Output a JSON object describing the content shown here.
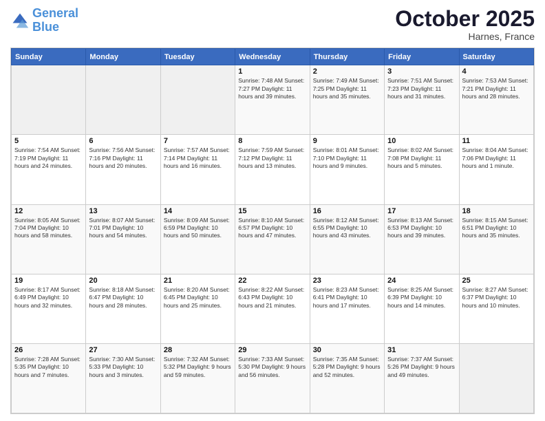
{
  "header": {
    "logo_line1": "General",
    "logo_line2": "Blue",
    "month": "October 2025",
    "location": "Harnes, France"
  },
  "weekdays": [
    "Sunday",
    "Monday",
    "Tuesday",
    "Wednesday",
    "Thursday",
    "Friday",
    "Saturday"
  ],
  "weeks": [
    [
      {
        "day": "",
        "info": ""
      },
      {
        "day": "",
        "info": ""
      },
      {
        "day": "",
        "info": ""
      },
      {
        "day": "1",
        "info": "Sunrise: 7:48 AM\nSunset: 7:27 PM\nDaylight: 11 hours\nand 39 minutes."
      },
      {
        "day": "2",
        "info": "Sunrise: 7:49 AM\nSunset: 7:25 PM\nDaylight: 11 hours\nand 35 minutes."
      },
      {
        "day": "3",
        "info": "Sunrise: 7:51 AM\nSunset: 7:23 PM\nDaylight: 11 hours\nand 31 minutes."
      },
      {
        "day": "4",
        "info": "Sunrise: 7:53 AM\nSunset: 7:21 PM\nDaylight: 11 hours\nand 28 minutes."
      }
    ],
    [
      {
        "day": "5",
        "info": "Sunrise: 7:54 AM\nSunset: 7:19 PM\nDaylight: 11 hours\nand 24 minutes."
      },
      {
        "day": "6",
        "info": "Sunrise: 7:56 AM\nSunset: 7:16 PM\nDaylight: 11 hours\nand 20 minutes."
      },
      {
        "day": "7",
        "info": "Sunrise: 7:57 AM\nSunset: 7:14 PM\nDaylight: 11 hours\nand 16 minutes."
      },
      {
        "day": "8",
        "info": "Sunrise: 7:59 AM\nSunset: 7:12 PM\nDaylight: 11 hours\nand 13 minutes."
      },
      {
        "day": "9",
        "info": "Sunrise: 8:01 AM\nSunset: 7:10 PM\nDaylight: 11 hours\nand 9 minutes."
      },
      {
        "day": "10",
        "info": "Sunrise: 8:02 AM\nSunset: 7:08 PM\nDaylight: 11 hours\nand 5 minutes."
      },
      {
        "day": "11",
        "info": "Sunrise: 8:04 AM\nSunset: 7:06 PM\nDaylight: 11 hours\nand 1 minute."
      }
    ],
    [
      {
        "day": "12",
        "info": "Sunrise: 8:05 AM\nSunset: 7:04 PM\nDaylight: 10 hours\nand 58 minutes."
      },
      {
        "day": "13",
        "info": "Sunrise: 8:07 AM\nSunset: 7:01 PM\nDaylight: 10 hours\nand 54 minutes."
      },
      {
        "day": "14",
        "info": "Sunrise: 8:09 AM\nSunset: 6:59 PM\nDaylight: 10 hours\nand 50 minutes."
      },
      {
        "day": "15",
        "info": "Sunrise: 8:10 AM\nSunset: 6:57 PM\nDaylight: 10 hours\nand 47 minutes."
      },
      {
        "day": "16",
        "info": "Sunrise: 8:12 AM\nSunset: 6:55 PM\nDaylight: 10 hours\nand 43 minutes."
      },
      {
        "day": "17",
        "info": "Sunrise: 8:13 AM\nSunset: 6:53 PM\nDaylight: 10 hours\nand 39 minutes."
      },
      {
        "day": "18",
        "info": "Sunrise: 8:15 AM\nSunset: 6:51 PM\nDaylight: 10 hours\nand 35 minutes."
      }
    ],
    [
      {
        "day": "19",
        "info": "Sunrise: 8:17 AM\nSunset: 6:49 PM\nDaylight: 10 hours\nand 32 minutes."
      },
      {
        "day": "20",
        "info": "Sunrise: 8:18 AM\nSunset: 6:47 PM\nDaylight: 10 hours\nand 28 minutes."
      },
      {
        "day": "21",
        "info": "Sunrise: 8:20 AM\nSunset: 6:45 PM\nDaylight: 10 hours\nand 25 minutes."
      },
      {
        "day": "22",
        "info": "Sunrise: 8:22 AM\nSunset: 6:43 PM\nDaylight: 10 hours\nand 21 minutes."
      },
      {
        "day": "23",
        "info": "Sunrise: 8:23 AM\nSunset: 6:41 PM\nDaylight: 10 hours\nand 17 minutes."
      },
      {
        "day": "24",
        "info": "Sunrise: 8:25 AM\nSunset: 6:39 PM\nDaylight: 10 hours\nand 14 minutes."
      },
      {
        "day": "25",
        "info": "Sunrise: 8:27 AM\nSunset: 6:37 PM\nDaylight: 10 hours\nand 10 minutes."
      }
    ],
    [
      {
        "day": "26",
        "info": "Sunrise: 7:28 AM\nSunset: 5:35 PM\nDaylight: 10 hours\nand 7 minutes."
      },
      {
        "day": "27",
        "info": "Sunrise: 7:30 AM\nSunset: 5:33 PM\nDaylight: 10 hours\nand 3 minutes."
      },
      {
        "day": "28",
        "info": "Sunrise: 7:32 AM\nSunset: 5:32 PM\nDaylight: 9 hours\nand 59 minutes."
      },
      {
        "day": "29",
        "info": "Sunrise: 7:33 AM\nSunset: 5:30 PM\nDaylight: 9 hours\nand 56 minutes."
      },
      {
        "day": "30",
        "info": "Sunrise: 7:35 AM\nSunset: 5:28 PM\nDaylight: 9 hours\nand 52 minutes."
      },
      {
        "day": "31",
        "info": "Sunrise: 7:37 AM\nSunset: 5:26 PM\nDaylight: 9 hours\nand 49 minutes."
      },
      {
        "day": "",
        "info": ""
      }
    ]
  ]
}
